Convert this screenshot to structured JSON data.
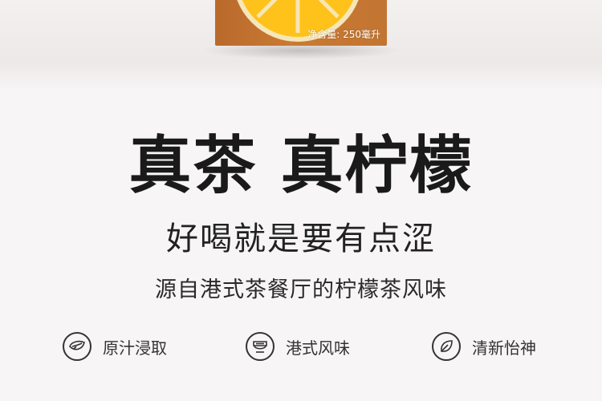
{
  "product": {
    "volume_text": "净含量: 250毫升"
  },
  "headline": "真茶 真柠檬",
  "subheadline": "好喝就是要有点涩",
  "tagline": "源自港式茶餐厅的柠檬茶风味",
  "features": [
    {
      "icon": "tea-leaf-icon",
      "label": "原汁浸取"
    },
    {
      "icon": "teacup-icon",
      "label": "港式风味"
    },
    {
      "icon": "leaf-icon",
      "label": "清新怡神"
    }
  ]
}
